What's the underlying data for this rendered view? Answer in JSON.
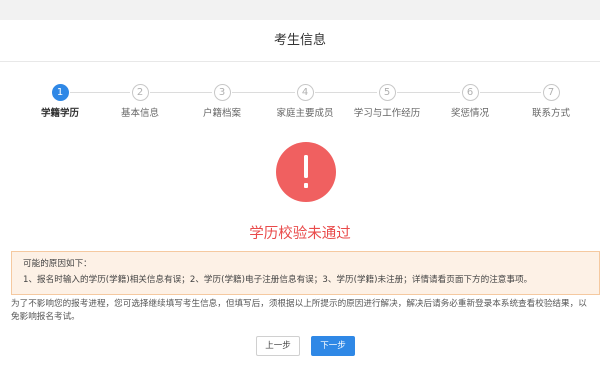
{
  "header": {
    "title": "考生信息"
  },
  "steps": [
    {
      "number": "1",
      "label": "学籍学历",
      "active": true
    },
    {
      "number": "2",
      "label": "基本信息"
    },
    {
      "number": "3",
      "label": "户籍档案"
    },
    {
      "number": "4",
      "label": "家庭主要成员"
    },
    {
      "number": "5",
      "label": "学习与工作经历"
    },
    {
      "number": "6",
      "label": "奖惩情况"
    },
    {
      "number": "7",
      "label": "联系方式"
    }
  ],
  "result": {
    "icon": "exclamation-icon",
    "title": "学历校验未通过",
    "color": "#e94b4b"
  },
  "reasons": {
    "heading": "可能的原因如下：",
    "text": "1、报名时输入的学历(学籍)相关信息有误；2、学历(学籍)电子注册信息有误；3、学历(学籍)未注册；详情请看页面下方的注意事项。"
  },
  "notice": "为了不影响您的报考进程，您可选择继续填写考生信息，但填写后，须根据以上所提示的原因进行解决，解决后请务必重新登录本系统查看校验结果，以免影响报名考试。",
  "buttons": {
    "prev": "上一步",
    "next": "下一步"
  },
  "colors": {
    "accent": "#2f88e6",
    "error": "#f06060",
    "warning_bg": "#fdf1e6"
  }
}
